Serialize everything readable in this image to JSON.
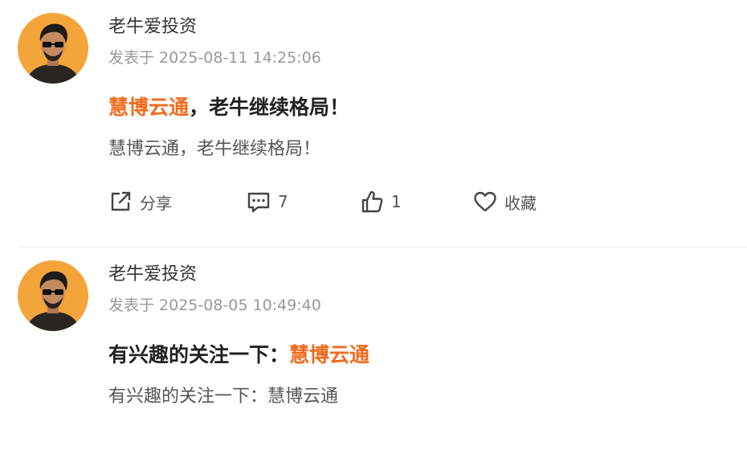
{
  "posts": [
    {
      "author": "老牛爱投资",
      "published_prefix": "发表于",
      "published_time": "2025-08-11 14:25:06",
      "title_highlight": "慧博云通",
      "title_rest": "，老牛继续格局！",
      "body": "慧博云通，老牛继续格局！",
      "actions": {
        "share_label": "分享",
        "comment_count": "7",
        "like_count": "1",
        "favorite_label": "收藏"
      }
    },
    {
      "author": "老牛爱投资",
      "published_prefix": "发表于",
      "published_time": "2025-08-05 10:49:40",
      "title_rest": "有兴趣的关注一下：",
      "title_highlight": "慧博云通",
      "body": "有兴趣的关注一下：慧博云通"
    }
  ],
  "colors": {
    "highlight": "#f26a1b",
    "avatar_bg": "#f3a43a",
    "meta_text": "#999999"
  },
  "icons": [
    "share-icon",
    "comment-icon",
    "like-icon",
    "favorite-icon"
  ]
}
